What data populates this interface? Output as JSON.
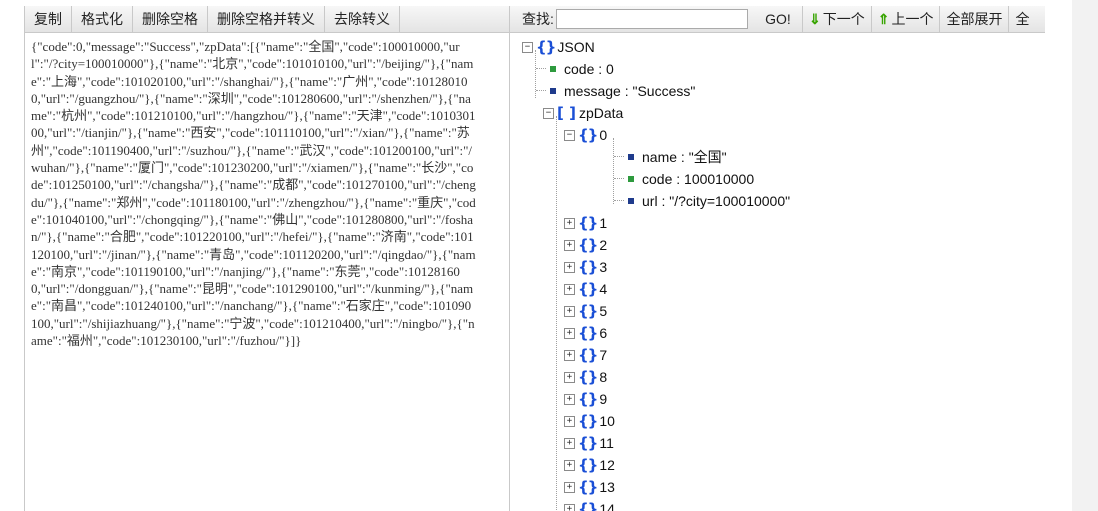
{
  "left_toolbar": {
    "copy": "复制",
    "format": "格式化",
    "remove_spaces": "删除空格",
    "remove_spaces_escape": "删除空格并转义",
    "unescape": "去除转义"
  },
  "raw_json": "{\"code\":0,\"message\":\"Success\",\"zpData\":[{\"name\":\"全国\",\"code\":100010000,\"url\":\"/?city=100010000\"},{\"name\":\"北京\",\"code\":101010100,\"url\":\"/beijing/\"},{\"name\":\"上海\",\"code\":101020100,\"url\":\"/shanghai/\"},{\"name\":\"广州\",\"code\":101280100,\"url\":\"/guangzhou/\"},{\"name\":\"深圳\",\"code\":101280600,\"url\":\"/shenzhen/\"},{\"name\":\"杭州\",\"code\":101210100,\"url\":\"/hangzhou/\"},{\"name\":\"天津\",\"code\":101030100,\"url\":\"/tianjin/\"},{\"name\":\"西安\",\"code\":101110100,\"url\":\"/xian/\"},{\"name\":\"苏州\",\"code\":101190400,\"url\":\"/suzhou/\"},{\"name\":\"武汉\",\"code\":101200100,\"url\":\"/wuhan/\"},{\"name\":\"厦门\",\"code\":101230200,\"url\":\"/xiamen/\"},{\"name\":\"长沙\",\"code\":101250100,\"url\":\"/changsha/\"},{\"name\":\"成都\",\"code\":101270100,\"url\":\"/chengdu/\"},{\"name\":\"郑州\",\"code\":101180100,\"url\":\"/zhengzhou/\"},{\"name\":\"重庆\",\"code\":101040100,\"url\":\"/chongqing/\"},{\"name\":\"佛山\",\"code\":101280800,\"url\":\"/foshan/\"},{\"name\":\"合肥\",\"code\":101220100,\"url\":\"/hefei/\"},{\"name\":\"济南\",\"code\":101120100,\"url\":\"/jinan/\"},{\"name\":\"青岛\",\"code\":101120200,\"url\":\"/qingdao/\"},{\"name\":\"南京\",\"code\":101190100,\"url\":\"/nanjing/\"},{\"name\":\"东莞\",\"code\":101281600,\"url\":\"/dongguan/\"},{\"name\":\"昆明\",\"code\":101290100,\"url\":\"/kunming/\"},{\"name\":\"南昌\",\"code\":101240100,\"url\":\"/nanchang/\"},{\"name\":\"石家庄\",\"code\":101090100,\"url\":\"/shijiazhuang/\"},{\"name\":\"宁波\",\"code\":101210400,\"url\":\"/ningbo/\"},{\"name\":\"福州\",\"code\":101230100,\"url\":\"/fuzhou/\"}]}",
  "right_toolbar": {
    "find_label": "查找:",
    "find_value": "",
    "go": "GO!",
    "next": "下一个",
    "prev": "上一个",
    "expand_all": "全部展开",
    "collapse_all_partial": "全"
  },
  "tree": {
    "root": "JSON",
    "code": "code : 0",
    "message": "message : \"Success\"",
    "zpdata": "zpData",
    "item0": "0",
    "item0_name": "name : \"全国\"",
    "item0_code": "code : 100010000",
    "item0_url": "url : \"/?city=100010000\"",
    "collapsed_items": [
      "1",
      "2",
      "3",
      "4",
      "5",
      "6",
      "7",
      "8",
      "9",
      "10",
      "11",
      "12",
      "13",
      "14"
    ]
  },
  "colors": {
    "number_marker": "#2e9a3e",
    "string_marker": "#1f3b8c",
    "brace": "#1a4fd6",
    "arrow": "#37a400"
  }
}
